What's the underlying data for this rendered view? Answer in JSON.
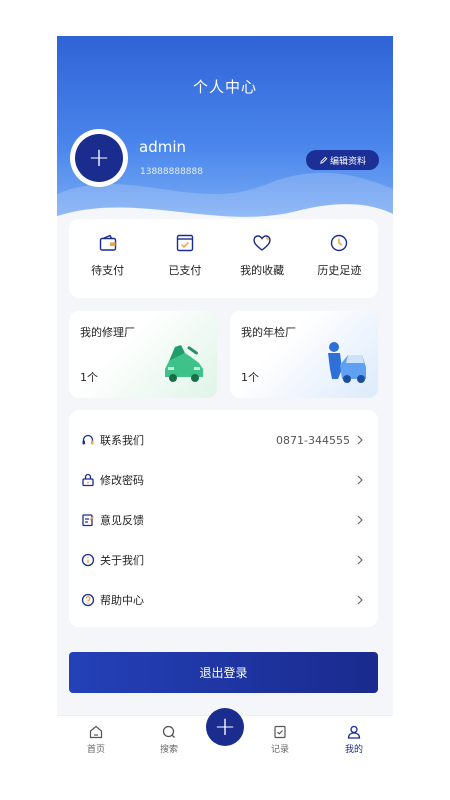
{
  "header": {
    "title": "个人中心",
    "username": "admin",
    "phone": "13888888888",
    "edit_label": "编辑资料",
    "avatar_icon": "plus-icon"
  },
  "quick_actions": [
    {
      "label": "待支付",
      "icon": "wallet-icon"
    },
    {
      "label": "已支付",
      "icon": "check-box-icon"
    },
    {
      "label": "我的收藏",
      "icon": "heart-icon"
    },
    {
      "label": "历史足迹",
      "icon": "clock-icon"
    }
  ],
  "garages": [
    {
      "title": "我的修理厂",
      "count": "1个",
      "illustration": "car-repair-illustration"
    },
    {
      "title": "我的年检厂",
      "count": "1个",
      "illustration": "car-inspection-illustration"
    }
  ],
  "menu": [
    {
      "label": "联系我们",
      "value": "0871-344555",
      "icon": "headset-icon"
    },
    {
      "label": "修改密码",
      "value": "",
      "icon": "lock-icon"
    },
    {
      "label": "意见反馈",
      "value": "",
      "icon": "edit-note-icon"
    },
    {
      "label": "关于我们",
      "value": "",
      "icon": "info-icon"
    },
    {
      "label": "帮助中心",
      "value": "",
      "icon": "help-icon"
    }
  ],
  "logout_label": "退出登录",
  "tabbar": {
    "items": [
      {
        "label": "首页",
        "icon": "home-icon"
      },
      {
        "label": "搜索",
        "icon": "search-icon"
      },
      {
        "label": "记录",
        "icon": "record-icon"
      },
      {
        "label": "我的",
        "icon": "user-icon"
      }
    ],
    "center_icon": "plus-icon",
    "active": "我的"
  },
  "colors": {
    "primary": "#1a2d8f",
    "header_blue": "#3a72e0",
    "icon_blue": "#1a2d8f",
    "accent_orange": "#f0a23c"
  }
}
